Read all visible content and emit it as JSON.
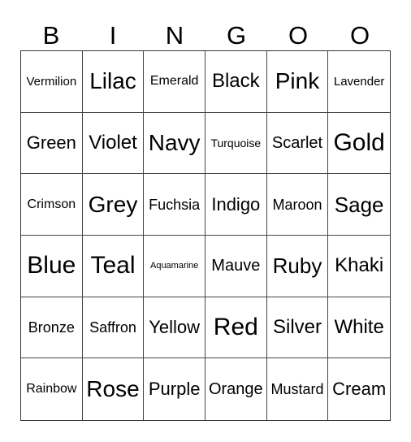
{
  "header": {
    "letters": [
      "B",
      "I",
      "N",
      "G",
      "O",
      "O"
    ]
  },
  "grid": {
    "rows": [
      [
        "Vermilion",
        "Lilac",
        "Emerald",
        "Black",
        "Pink",
        "Lavender"
      ],
      [
        "Green",
        "Violet",
        "Navy",
        "Turquoise",
        "Scarlet",
        "Gold"
      ],
      [
        "Crimson",
        "Grey",
        "Fuchsia",
        "Indigo",
        "Maroon",
        "Sage"
      ],
      [
        "Blue",
        "Teal",
        "Aquamarine",
        "Mauve",
        "Ruby",
        "Khaki"
      ],
      [
        "Bronze",
        "Saffron",
        "Yellow",
        "Red",
        "Silver",
        "White"
      ],
      [
        "Rainbow",
        "Rose",
        "Purple",
        "Orange",
        "Mustard",
        "Cream"
      ]
    ]
  }
}
